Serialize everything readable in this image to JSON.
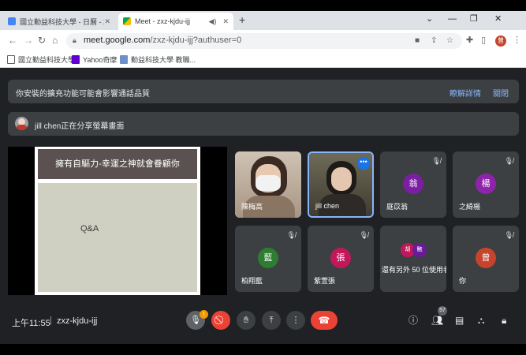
{
  "browser": {
    "tabs": [
      {
        "title": "國立勤益科技大學 - 日曆 - 2022年...",
        "active": false
      },
      {
        "title": "Meet - zxz-kjdu-ijj",
        "active": true
      }
    ],
    "new_tab": "+",
    "url_main": "meet.google.com",
    "url_path": "/zxz-kjdu-ijj?authuser=0",
    "profile_initial": "曾",
    "bookmarks": [
      {
        "label": "國立勤益科技大學"
      },
      {
        "label": "Yahoo奇摩"
      },
      {
        "label": "勤益科技大學 教職..."
      }
    ]
  },
  "banner": {
    "message": "你安裝的擴充功能可能會影響通話品質",
    "details": "瞭解詳情",
    "close": "關閉"
  },
  "presenting": {
    "text": "jill chen正在分享螢幕畫面"
  },
  "slide": {
    "title": "擁有自驅力-幸運之神就會眷顧你",
    "body": "Q&A"
  },
  "participants": [
    {
      "name": "陳梅高"
    },
    {
      "name": "jill chen"
    },
    {
      "name": "庭苡翁",
      "initial": "翁",
      "color": "#7b1fa2"
    },
    {
      "name": "之綺楊",
      "initial": "楊",
      "color": "#8e24aa"
    },
    {
      "name": "柏翔藍",
      "initial": "藍",
      "color": "#2e7d32"
    },
    {
      "name": "紫萱張",
      "initial": "張",
      "color": "#c2185b"
    },
    {
      "name": "還有另外 50 位使用者",
      "minis": [
        "胡",
        "鮑"
      ]
    },
    {
      "name": "你",
      "initial": "曾",
      "color": "#c5442b"
    }
  ],
  "footer": {
    "time": "上午11:55",
    "separator": "|",
    "meeting_code": "zxz-kjdu-ijj",
    "participant_count": "57",
    "warning": "!"
  }
}
